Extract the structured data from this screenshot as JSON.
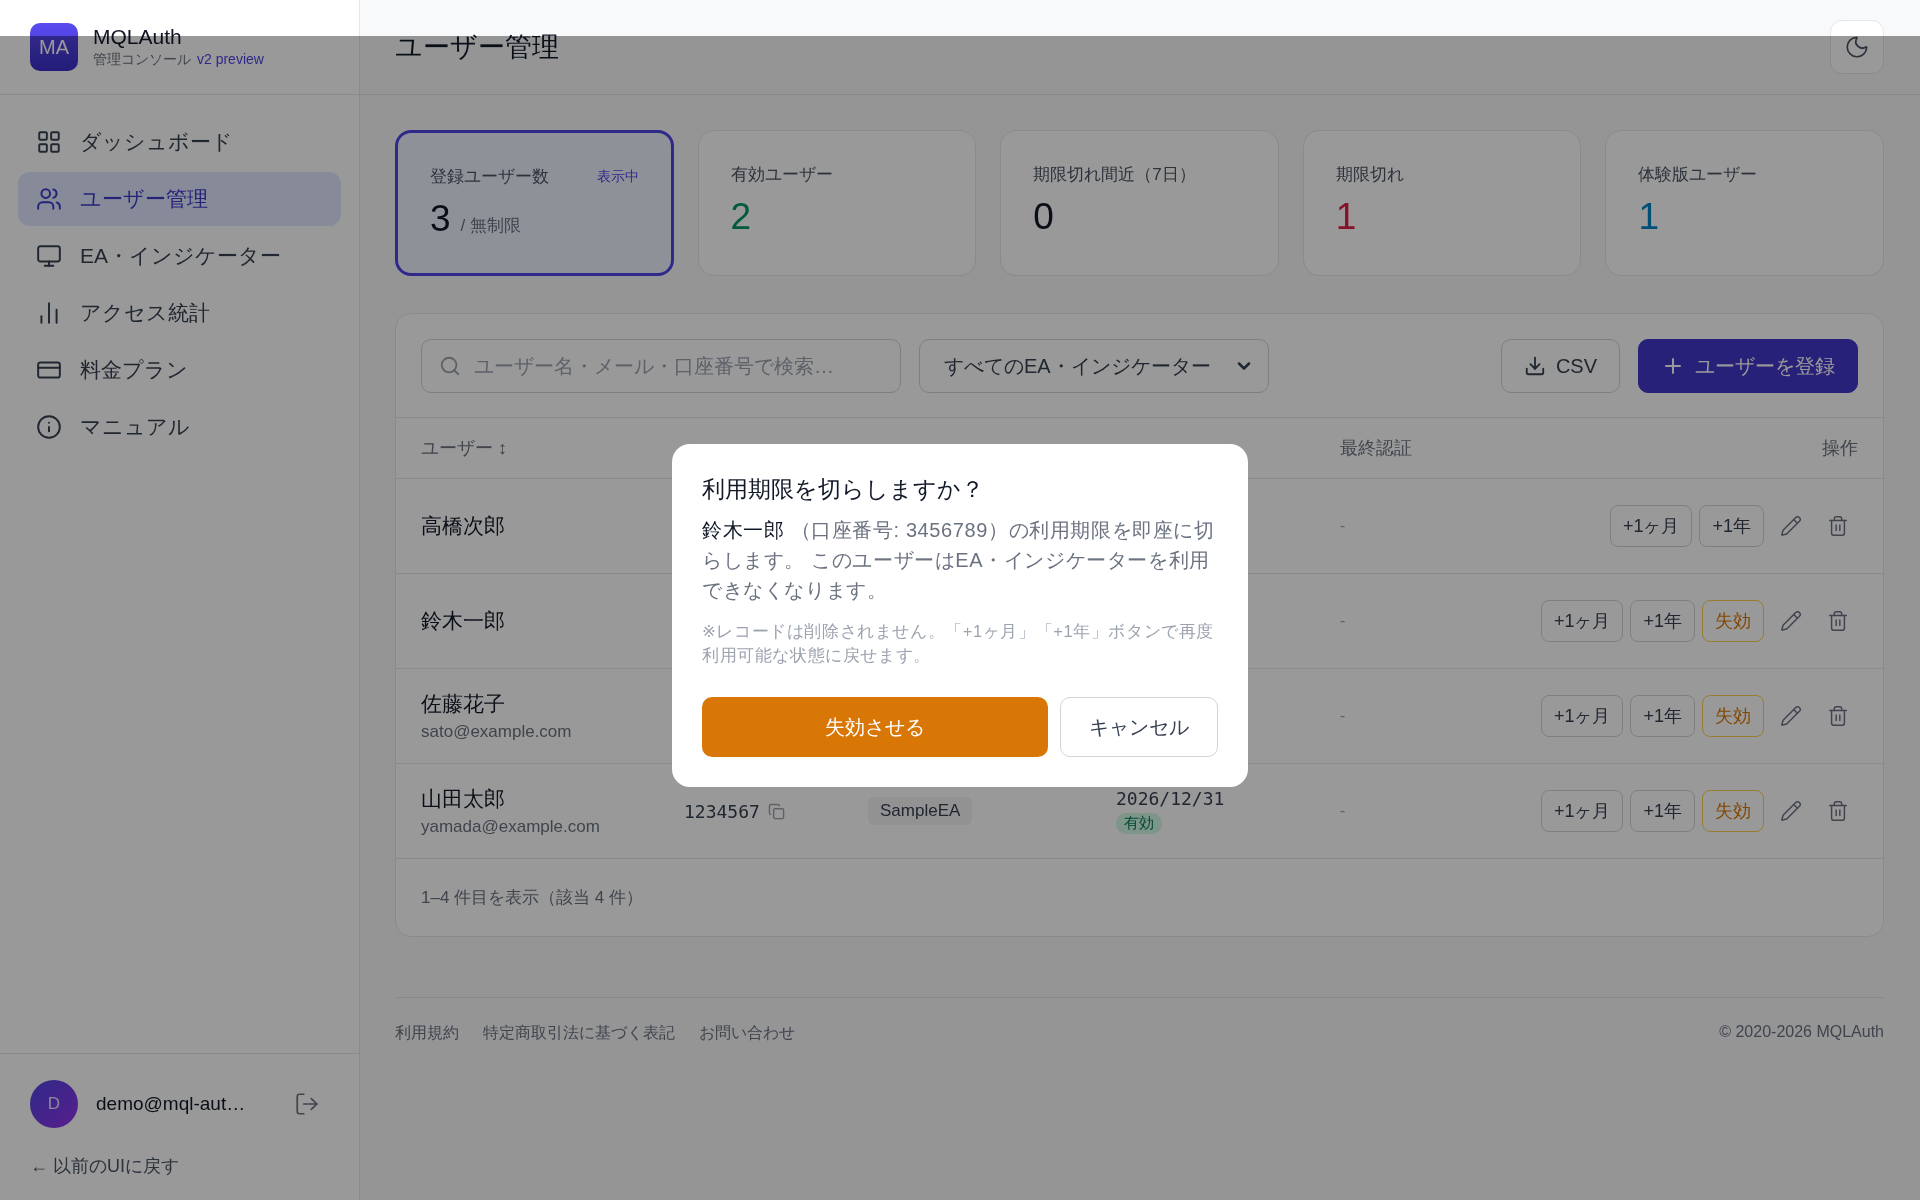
{
  "sidebar": {
    "logo": "MA",
    "app_name": "MQLAuth",
    "subtitle": "管理コンソール",
    "version": "v2 preview",
    "items": [
      {
        "label": "ダッシュボード",
        "selected": false
      },
      {
        "label": "ユーザー管理",
        "selected": true
      },
      {
        "label": "EA・インジケーター",
        "selected": false
      },
      {
        "label": "アクセス統計",
        "selected": false
      },
      {
        "label": "料金プラン",
        "selected": false
      },
      {
        "label": "マニュアル",
        "selected": false
      }
    ],
    "user": {
      "initial": "D",
      "email": "demo@mql-aut…"
    },
    "back_link": "← 以前のUIに戻す"
  },
  "header": {
    "title": "ユーザー管理"
  },
  "stats": [
    {
      "label": "登録ユーザー数",
      "value": "3",
      "suffix": "/ 無制限",
      "badge": "表示中",
      "selected": true,
      "kind": "neutral"
    },
    {
      "label": "有効ユーザー",
      "value": "2",
      "selected": false,
      "kind": "positive"
    },
    {
      "label": "期限切れ間近（7日）",
      "value": "0",
      "selected": false,
      "kind": "neutral"
    },
    {
      "label": "期限切れ",
      "value": "1",
      "selected": false,
      "kind": "negative"
    },
    {
      "label": "体験版ユーザー",
      "value": "1",
      "selected": false,
      "kind": "info"
    }
  ],
  "toolbar": {
    "search_placeholder": "ユーザー名・メール・口座番号で検索…",
    "filter": "すべてのEA・インジケーター",
    "csv": "CSV",
    "add": "ユーザーを登録"
  },
  "table": {
    "columns": [
      {
        "label": "ユーザー",
        "sort_mark": "↕"
      },
      {
        "label": "最終認証"
      },
      {
        "label": "操作"
      }
    ],
    "rows": [
      {
        "name": "高橋次郎",
        "last_auth": "-",
        "actions": [
          {
            "label": "+1ヶ月",
            "kind": "extend"
          },
          {
            "label": "+1年",
            "kind": "extend"
          }
        ]
      },
      {
        "name": "鈴木一郎",
        "last_auth": "-",
        "actions": [
          {
            "label": "+1ヶ月",
            "kind": "extend"
          },
          {
            "label": "+1年",
            "kind": "extend"
          },
          {
            "label": "失効",
            "kind": "revoke"
          }
        ]
      },
      {
        "name": "佐藤花子",
        "email": "sato@example.com",
        "last_auth": "-",
        "actions": [
          {
            "label": "+1ヶ月",
            "kind": "extend"
          },
          {
            "label": "+1年",
            "kind": "extend"
          },
          {
            "label": "失効",
            "kind": "revoke"
          }
        ]
      },
      {
        "name": "山田太郎",
        "email": "yamada@example.com",
        "account": "1234567",
        "ea": "SampleEA",
        "expiry": "2026/12/31",
        "status": "有効",
        "last_auth": "-",
        "actions": [
          {
            "label": "+1ヶ月",
            "kind": "extend"
          },
          {
            "label": "+1年",
            "kind": "extend"
          },
          {
            "label": "失効",
            "kind": "revoke"
          }
        ]
      }
    ],
    "summary": "1–4 件目を表示（該当 4 件）"
  },
  "footer": {
    "links": [
      "利用規約",
      "特定商取引法に基づく表記",
      "お問い合わせ"
    ],
    "copyright": "© 2020-2026 MQLAuth"
  },
  "dialog": {
    "title": "利用期限を切らしますか？",
    "target": "鈴木一郎",
    "message": " （口座番号: 3456789）の利用期限を即座に切らします。 このユーザーはEA・インジケーターを利用できなくなります。",
    "note": "※レコードは削除されません。「+1ヶ月」「+1年」ボタンで再度利用可能な状態に戻せます。",
    "confirm": "失効させる",
    "cancel": "キャンセル"
  }
}
